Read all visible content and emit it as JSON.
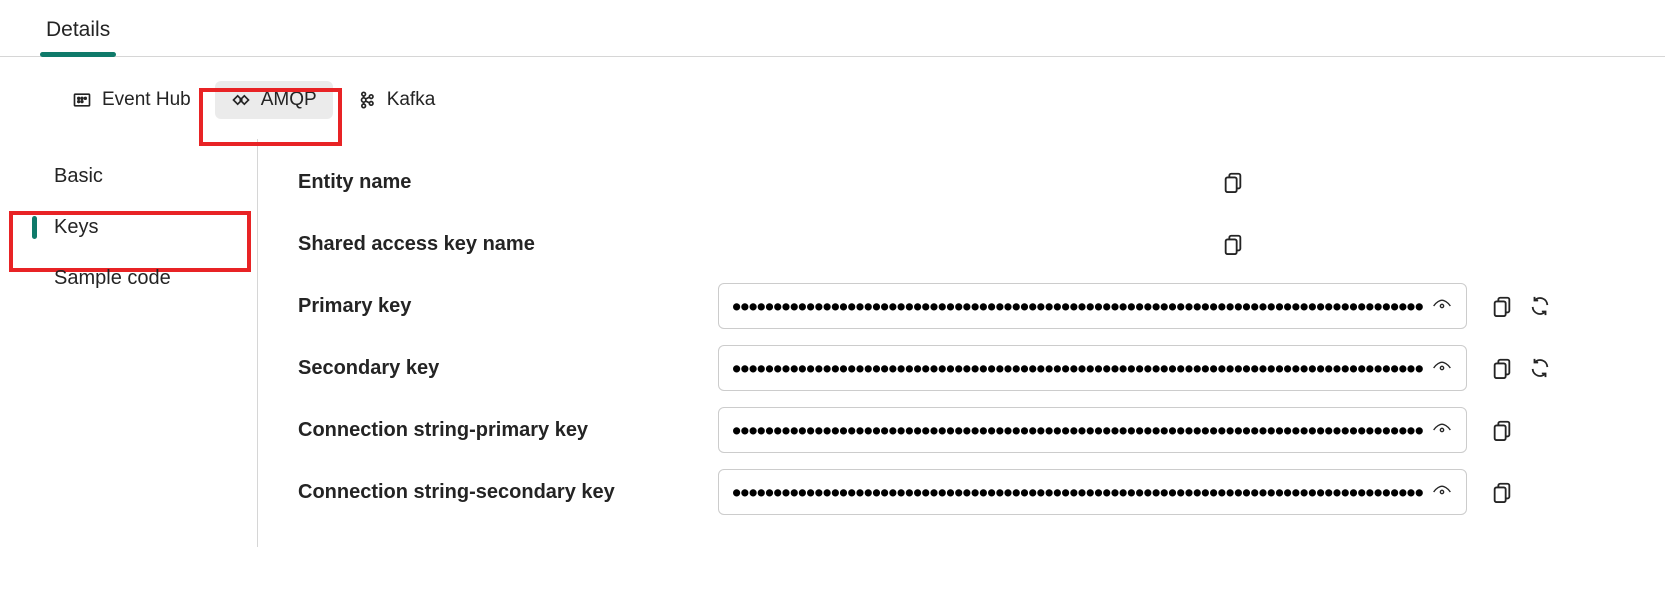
{
  "topTabs": {
    "details": "Details"
  },
  "protocolTabs": {
    "eventhub": "Event Hub",
    "amqp": "AMQP",
    "kafka": "Kafka"
  },
  "sidebar": {
    "basic": "Basic",
    "keys": "Keys",
    "sample": "Sample code"
  },
  "fields": {
    "entityName": {
      "label": "Entity name",
      "value": ""
    },
    "sharedAccessKeyName": {
      "label": "Shared access key name",
      "value": ""
    },
    "primaryKey": {
      "label": "Primary key",
      "masked": true
    },
    "secondaryKey": {
      "label": "Secondary key",
      "masked": true
    },
    "connPrimary": {
      "label": "Connection string-primary key",
      "masked": true
    },
    "connSecondary": {
      "label": "Connection string-secondary key",
      "masked": true
    }
  },
  "icons": {
    "copy": "copy-icon",
    "reveal": "eye-icon",
    "refresh": "refresh-icon"
  }
}
